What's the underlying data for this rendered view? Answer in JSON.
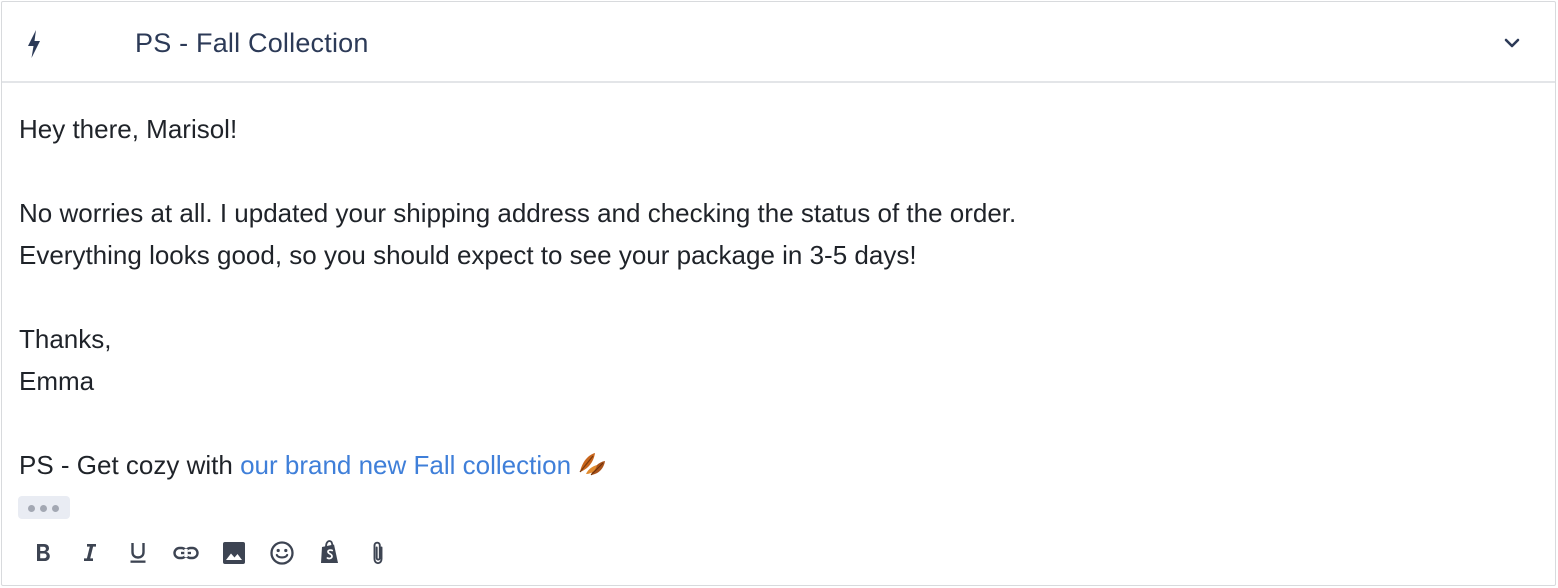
{
  "header": {
    "macro_icon": "lightning-bolt-icon",
    "title": "PS - Fall Collection",
    "toggle_icon": "chevron-down-icon"
  },
  "message": {
    "greeting": "Hey there, Marisol!",
    "line1": "No worries at all. I updated your shipping address and checking the status of the order.",
    "line2": "Everything looks good, so you should expect to see your package in 3-5 days!",
    "signoff": "Thanks,",
    "signature": "Emma",
    "ps_prefix": "PS - Get cozy with ",
    "ps_link": "our brand new Fall collection",
    "ps_emoji_icon": "fallen-leaf-icon"
  },
  "more_button": {
    "icon": "ellipsis-icon"
  },
  "toolbar": {
    "tools": [
      "bold-icon",
      "italic-icon",
      "underline-icon",
      "link-icon",
      "image-icon",
      "emoji-icon",
      "shopify-icon",
      "attachment-icon"
    ]
  },
  "colors": {
    "title": "#2c3a57",
    "text": "#1f2329",
    "link": "#3f7fd9",
    "toolbar_icon": "#3d4452",
    "border": "#d8dadd"
  }
}
